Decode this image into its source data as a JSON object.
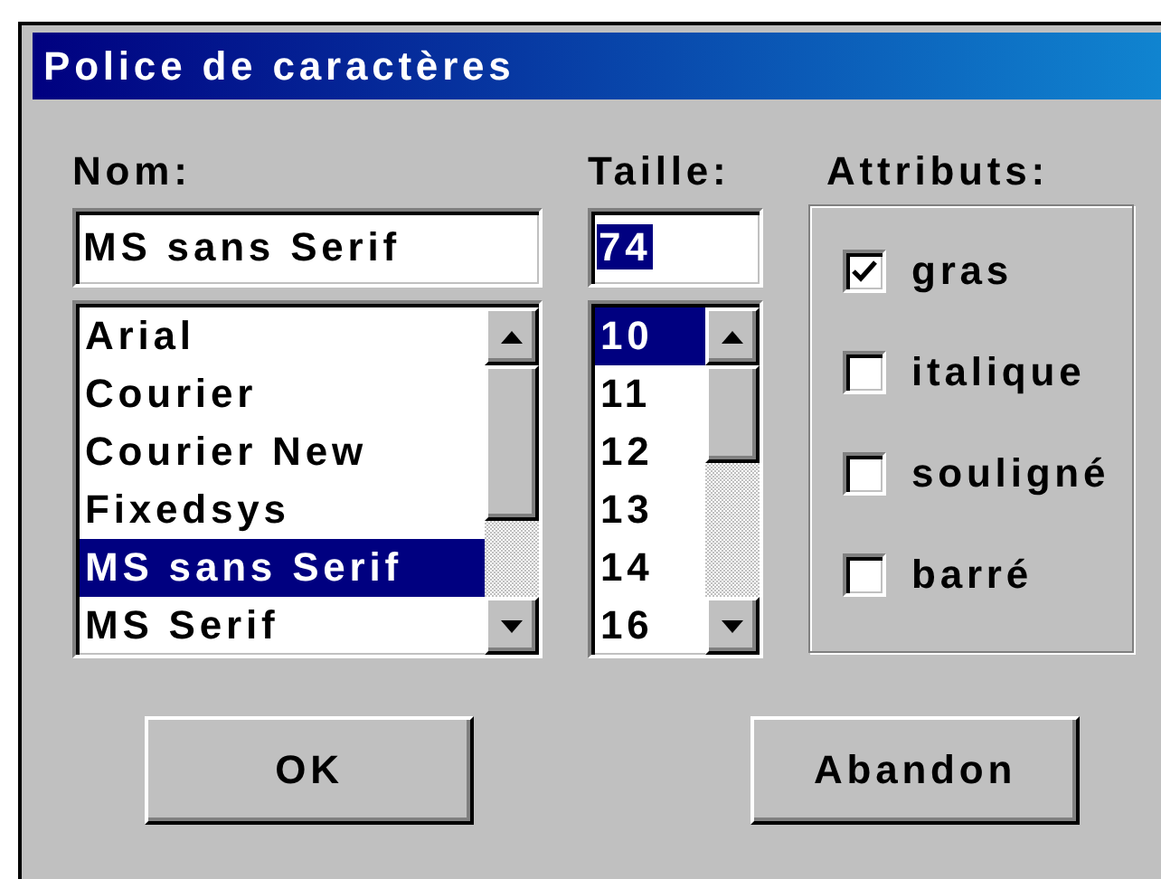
{
  "window": {
    "title": "Police de caractères"
  },
  "name": {
    "label": "Nom:",
    "value": "MS sans Serif",
    "value_selected": false,
    "items": [
      {
        "label": "Arial",
        "selected": false
      },
      {
        "label": "Courier",
        "selected": false
      },
      {
        "label": "Courier New",
        "selected": false
      },
      {
        "label": "Fixedsys",
        "selected": false
      },
      {
        "label": "MS sans Serif",
        "selected": true
      },
      {
        "label": "MS Serif",
        "selected": false
      }
    ]
  },
  "size": {
    "label": "Taille:",
    "value": "74",
    "value_selected": true,
    "items": [
      {
        "label": "10",
        "selected": true
      },
      {
        "label": "11",
        "selected": false
      },
      {
        "label": "12",
        "selected": false
      },
      {
        "label": "13",
        "selected": false
      },
      {
        "label": "14",
        "selected": false
      },
      {
        "label": "16",
        "selected": false
      }
    ]
  },
  "attributes": {
    "label": "Attributs:",
    "options": [
      {
        "label": "gras",
        "checked": true
      },
      {
        "label": "italique",
        "checked": false
      },
      {
        "label": "souligné",
        "checked": false
      },
      {
        "label": "barré",
        "checked": false
      }
    ]
  },
  "buttons": [
    {
      "label": "OK"
    },
    {
      "label": "Abandon"
    }
  ]
}
